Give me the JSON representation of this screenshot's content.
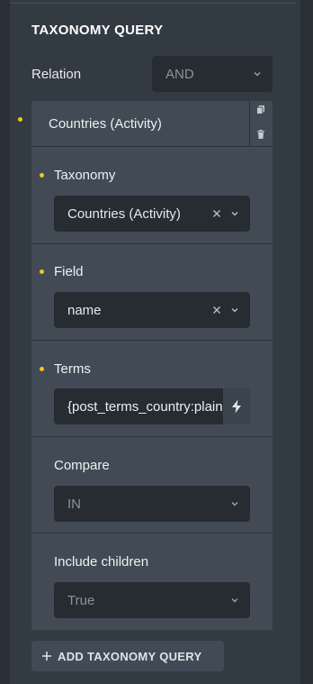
{
  "panel": {
    "section_title": "TAXONOMY QUERY",
    "relation": {
      "label": "Relation",
      "value": "AND"
    },
    "query_item": {
      "title": "Countries (Activity)",
      "fields": {
        "taxonomy": {
          "label": "Taxonomy",
          "value": "Countries (Activity)"
        },
        "field": {
          "label": "Field",
          "value": "name"
        },
        "terms": {
          "label": "Terms",
          "value": "{post_terms_country:plain}"
        },
        "compare": {
          "label": "Compare",
          "value": "IN"
        },
        "include_children": {
          "label": "Include children",
          "value": "True"
        }
      }
    },
    "add_button_label": "ADD TAXONOMY QUERY"
  },
  "icons": {
    "copy": "copy-icon",
    "delete": "trash-icon",
    "clear": "close-icon",
    "chevron": "chevron-down-icon",
    "dynamic_data": "bolt-icon",
    "add": "plus-icon"
  },
  "colors": {
    "panel_bg": "#323a42",
    "card_bg": "#424b55",
    "input_bg": "#262c32",
    "indicator": "#f5c518"
  }
}
